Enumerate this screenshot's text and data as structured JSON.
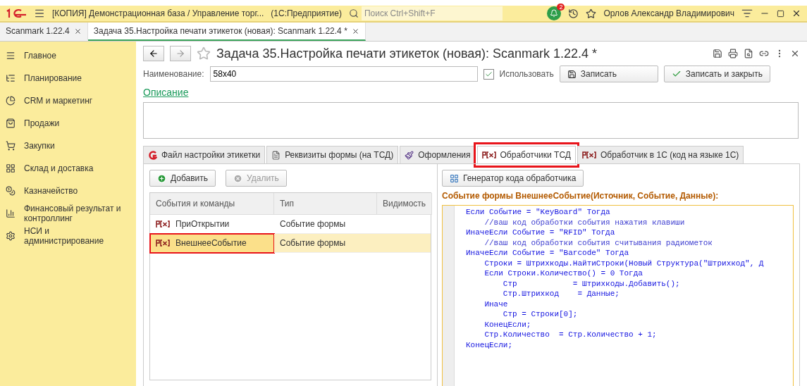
{
  "titlebar": {
    "title": "[КОПИЯ] Демонстрационная база / Управление торг...",
    "app": "(1С:Предприятие)",
    "search_placeholder": "Поиск Ctrl+Shift+F",
    "notifications": "2",
    "user": "Орлов Александр Владимирович"
  },
  "doc_tabs": [
    {
      "label": "Scanmark 1.22.4",
      "selected": false
    },
    {
      "label": "Задача 35.Настройка печати этикеток (новая): Scanmark 1.22.4 *",
      "selected": true
    }
  ],
  "sidebar": {
    "items": [
      {
        "label": "Главное"
      },
      {
        "label": "Планирование"
      },
      {
        "label": "CRM и маркетинг"
      },
      {
        "label": "Продажи"
      },
      {
        "label": "Закупки"
      },
      {
        "label": "Склад и доставка"
      },
      {
        "label": "Казначейство"
      },
      {
        "label": "Финансовый результат и контроллинг"
      },
      {
        "label": "НСИ и администрирование"
      }
    ]
  },
  "form": {
    "title": "Задача 35.Настройка печати этикеток (новая): Scanmark 1.22.4 *",
    "name_label": "Наименование:",
    "name_value": "58x40",
    "use_label": "Использовать",
    "use_checked": true,
    "save": "Записать",
    "save_close": "Записать и закрыть",
    "description_link": "Описание",
    "tabs": [
      {
        "label": "Файл настройки этикетки",
        "selected": false,
        "highlighted": false
      },
      {
        "label": "Реквизиты формы (на ТСД)",
        "selected": false,
        "highlighted": false
      },
      {
        "label": "Оформления",
        "selected": false,
        "highlighted": false
      },
      {
        "label": "Обработчики ТСД",
        "selected": true,
        "highlighted": true
      },
      {
        "label": "Обработчик в 1С  (код на языке 1С)",
        "selected": false,
        "highlighted": false
      }
    ],
    "add": "Добавить",
    "delete": "Удалить",
    "delete_disabled": true,
    "table": {
      "columns": [
        "События и команды",
        "Тип",
        "Видимость"
      ],
      "rows": [
        {
          "name": "ПриОткрытии",
          "type": "Событие формы",
          "selected": false,
          "highlighted": false
        },
        {
          "name": "ВнешнееСобытие",
          "type": "Событие формы",
          "selected": true,
          "highlighted": true
        }
      ]
    },
    "generator": "Генератор кода обработчика",
    "code_title": "Событие формы ВнешнееСобытие(Источник, Событие, Данные):",
    "code_lines": [
      {
        "text": "Если Событие = \"KeyBoard\" Тогда",
        "kind": "code"
      },
      {
        "text": "    //ваш код обработки события нажатия клавиши",
        "kind": "comment"
      },
      {
        "text": "ИначеЕсли Событие = \"RFID\" Тогда",
        "kind": "code"
      },
      {
        "text": "    //ваш код обработки события считывания радиометок",
        "kind": "comment"
      },
      {
        "text": "ИначеЕсли Событие = \"Barcode\" Тогда",
        "kind": "code"
      },
      {
        "text": "    Строки = Штрихкоды.НайтиСтроки(Новый Структура(\"Штрихкод\", Д",
        "kind": "code"
      },
      {
        "text": "    Если Строки.Количество() = 0 Тогда",
        "kind": "code"
      },
      {
        "text": "        Стр            = Штрихкоды.Добавить();",
        "kind": "code"
      },
      {
        "text": "        Стр.Штрихкод    = Данные;",
        "kind": "code"
      },
      {
        "text": "    Иначе",
        "kind": "code"
      },
      {
        "text": "        Стр = Строки[0];",
        "kind": "code"
      },
      {
        "text": "    КонецЕсли;",
        "kind": "code"
      },
      {
        "text": "    Стр.Количество  = Стр.Количество + 1;",
        "kind": "code"
      },
      {
        "text": "КонецЕсли;",
        "kind": "code"
      }
    ]
  }
}
